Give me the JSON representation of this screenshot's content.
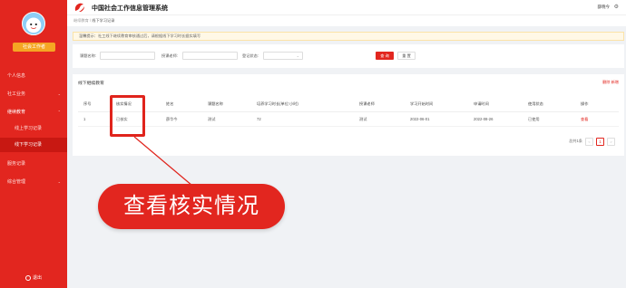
{
  "sidebar": {
    "role_badge": "社会工作者",
    "items": [
      {
        "label": "个人信息",
        "arrow": ""
      },
      {
        "label": "社工业务",
        "arrow": "⌄"
      },
      {
        "label": "继续教育",
        "arrow": "⌃"
      },
      {
        "label": "线上学习记录",
        "arrow": ""
      },
      {
        "label": "线下学习记录",
        "arrow": ""
      },
      {
        "label": "服务记录",
        "arrow": ""
      },
      {
        "label": "综合管理",
        "arrow": "⌄"
      }
    ],
    "logout": "退出"
  },
  "header": {
    "title": "中国社会工作信息管理系统",
    "user": "薛晓今"
  },
  "breadcrumb": {
    "parent": "继续教育",
    "separator": "/",
    "current": "线下学习记录"
  },
  "notice": {
    "text": "温馨提示：社工线下继续教育审核通过后，请根据线下学习时长据实填写"
  },
  "filter": {
    "course_name_label": "课题名称:",
    "teacher_label": "授课老师:",
    "status_label": "登记状态:",
    "select_value": "",
    "query_label": "查 询",
    "reset_label": "重 置"
  },
  "table": {
    "title": "线下继续教育",
    "actions": "删除 新增",
    "columns": [
      "序号",
      "核实情况",
      "姓名",
      "课题名称",
      "培养学习时长(单位:小时)",
      "授课老师",
      "学习开始时间",
      "申请时间",
      "使用状态",
      "操作"
    ],
    "rows": [
      [
        "1",
        "已核实",
        "薛华今",
        "测试",
        "72",
        "测试",
        "2022-06-01",
        "2022-08-26",
        "已使用",
        "查看"
      ]
    ]
  },
  "pager": {
    "total": "总共1条",
    "prev": "<",
    "page": "1",
    "next": ">"
  },
  "callout": {
    "text": "查看核实情况"
  },
  "colors": {
    "brand_red": "#e2261f",
    "badge_orange": "#f5a623",
    "notice_bg": "#fff8e6"
  }
}
